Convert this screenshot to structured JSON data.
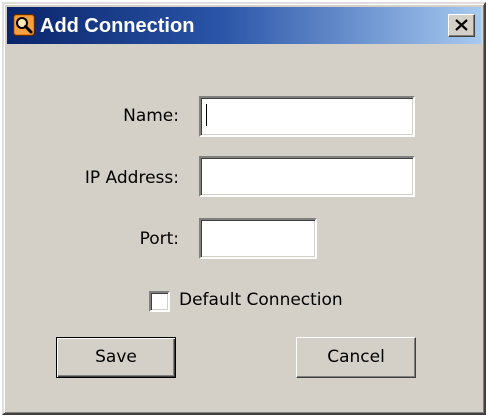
{
  "window": {
    "title": "Add Connection",
    "app_icon": "magnifier-icon",
    "close_icon": "close-icon"
  },
  "form": {
    "name_label": "Name:",
    "name_value": "",
    "ip_label": "IP Address:",
    "ip_value": "",
    "port_label": "Port:",
    "port_value": "",
    "default_checkbox_label": "Default Connection",
    "default_checked": false
  },
  "buttons": {
    "save_label": "Save",
    "cancel_label": "Cancel"
  },
  "colors": {
    "title_gradient_start": "#0a246a",
    "title_gradient_end": "#a6caf0",
    "dialog_face": "#d4d0c8",
    "icon_accent": "#e8801e"
  }
}
